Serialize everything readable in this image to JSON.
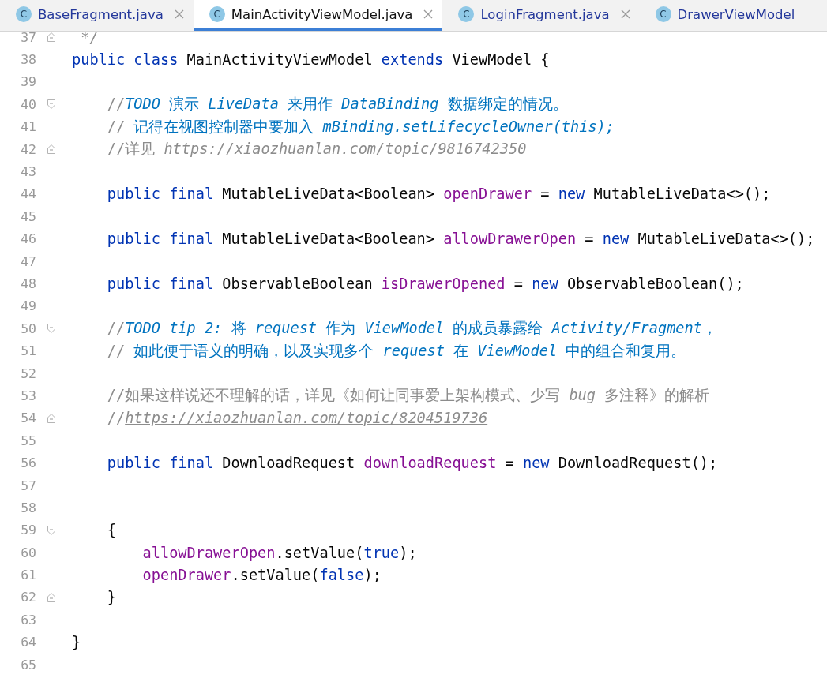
{
  "tabs": [
    {
      "label": "BaseFragment.java",
      "selected": false,
      "closable": true,
      "icon": "C"
    },
    {
      "label": "MainActivityViewModel.java",
      "selected": true,
      "closable": true,
      "icon": "C"
    },
    {
      "label": "LoginFragment.java",
      "selected": false,
      "closable": true,
      "icon": "C"
    },
    {
      "label": "DrawerViewModel",
      "selected": false,
      "closable": false,
      "icon": "C"
    }
  ],
  "lines": [
    {
      "number": "37",
      "fold": {
        "kind": "end"
      },
      "tokens": [
        {
          "kind": "doc",
          "text": " */"
        }
      ]
    },
    {
      "number": "38",
      "tokens": [
        {
          "kind": "keyword",
          "text": "public class "
        },
        {
          "kind": "plain",
          "text": "MainActivityViewModel "
        },
        {
          "kind": "keyword",
          "text": "extends "
        },
        {
          "kind": "plain",
          "text": "ViewModel {"
        }
      ]
    },
    {
      "number": "39"
    },
    {
      "number": "40",
      "fold": {
        "kind": "start"
      },
      "tokens": [
        {
          "kind": "comment",
          "text": "    //"
        },
        {
          "kind": "todo-code",
          "text": "TODO"
        },
        {
          "kind": "todo",
          "text": " 演示 "
        },
        {
          "kind": "todo-code",
          "text": "LiveData"
        },
        {
          "kind": "todo",
          "text": " 来用作 "
        },
        {
          "kind": "todo-code",
          "text": "DataBinding"
        },
        {
          "kind": "todo",
          "text": " 数据绑定的情况。"
        }
      ]
    },
    {
      "number": "41",
      "tokens": [
        {
          "kind": "comment",
          "text": "    // "
        },
        {
          "kind": "todo",
          "text": "记得在视图控制器中要加入 "
        },
        {
          "kind": "todo-code",
          "text": "mBinding.setLifecycleOwner(this);"
        }
      ]
    },
    {
      "number": "42",
      "fold": {
        "kind": "end"
      },
      "tokens": [
        {
          "kind": "comment",
          "text": "    //详见 "
        },
        {
          "kind": "link",
          "text": "https://xiaozhuanlan.com/topic/9816742350"
        }
      ]
    },
    {
      "number": "43"
    },
    {
      "number": "44",
      "tokens": [
        {
          "kind": "keyword",
          "text": "    public final "
        },
        {
          "kind": "plain",
          "text": "MutableLiveData<Boolean> "
        },
        {
          "kind": "field",
          "text": "openDrawer"
        },
        {
          "kind": "plain",
          "text": " = "
        },
        {
          "kind": "keyword",
          "text": "new "
        },
        {
          "kind": "plain",
          "text": "MutableLiveData<>();"
        }
      ]
    },
    {
      "number": "45"
    },
    {
      "number": "46",
      "tokens": [
        {
          "kind": "keyword",
          "text": "    public final "
        },
        {
          "kind": "plain",
          "text": "MutableLiveData<Boolean> "
        },
        {
          "kind": "field",
          "text": "allowDrawerOpen"
        },
        {
          "kind": "plain",
          "text": " = "
        },
        {
          "kind": "keyword",
          "text": "new "
        },
        {
          "kind": "plain",
          "text": "MutableLiveData<>();"
        }
      ]
    },
    {
      "number": "47"
    },
    {
      "number": "48",
      "tokens": [
        {
          "kind": "keyword",
          "text": "    public final "
        },
        {
          "kind": "plain",
          "text": "ObservableBoolean "
        },
        {
          "kind": "field",
          "text": "isDrawerOpened"
        },
        {
          "kind": "plain",
          "text": " = "
        },
        {
          "kind": "keyword",
          "text": "new "
        },
        {
          "kind": "plain",
          "text": "ObservableBoolean();"
        }
      ]
    },
    {
      "number": "49"
    },
    {
      "number": "50",
      "fold": {
        "kind": "start"
      },
      "tokens": [
        {
          "kind": "comment",
          "text": "    //"
        },
        {
          "kind": "todo-code",
          "text": "TODO tip 2:"
        },
        {
          "kind": "todo",
          "text": " 将 "
        },
        {
          "kind": "todo-code",
          "text": "request"
        },
        {
          "kind": "todo",
          "text": " 作为 "
        },
        {
          "kind": "todo-code",
          "text": "ViewModel"
        },
        {
          "kind": "todo",
          "text": " 的成员暴露给 "
        },
        {
          "kind": "todo-code",
          "text": "Activity/Fragment"
        },
        {
          "kind": "todo",
          "text": "，"
        }
      ]
    },
    {
      "number": "51",
      "tokens": [
        {
          "kind": "comment",
          "text": "    // "
        },
        {
          "kind": "todo",
          "text": "如此便于语义的明确，以及实现多个 "
        },
        {
          "kind": "todo-code",
          "text": "request"
        },
        {
          "kind": "todo",
          "text": " 在 "
        },
        {
          "kind": "todo-code",
          "text": "ViewModel"
        },
        {
          "kind": "todo",
          "text": " 中的组合和复用。"
        }
      ]
    },
    {
      "number": "52"
    },
    {
      "number": "53",
      "tokens": [
        {
          "kind": "comment",
          "text": "    //如果这样说还不理解的话，详见《如何让同事爱上架构模式、少写 "
        },
        {
          "kind": "doc",
          "text": "bug"
        },
        {
          "kind": "comment",
          "text": " 多注释》的解析"
        }
      ]
    },
    {
      "number": "54",
      "fold": {
        "kind": "end"
      },
      "tokens": [
        {
          "kind": "comment",
          "text": "    //"
        },
        {
          "kind": "link",
          "text": "https://xiaozhuanlan.com/topic/8204519736"
        }
      ]
    },
    {
      "number": "55"
    },
    {
      "number": "56",
      "tokens": [
        {
          "kind": "keyword",
          "text": "    public final "
        },
        {
          "kind": "plain",
          "text": "DownloadRequest "
        },
        {
          "kind": "field",
          "text": "downloadRequest"
        },
        {
          "kind": "plain",
          "text": " = "
        },
        {
          "kind": "keyword",
          "text": "new "
        },
        {
          "kind": "plain",
          "text": "DownloadRequest();"
        }
      ]
    },
    {
      "number": "57"
    },
    {
      "number": "58"
    },
    {
      "number": "59",
      "fold": {
        "kind": "start"
      },
      "tokens": [
        {
          "kind": "plain",
          "text": "    {"
        }
      ]
    },
    {
      "number": "60",
      "tokens": [
        {
          "kind": "field",
          "text": "        allowDrawerOpen"
        },
        {
          "kind": "plain",
          "text": ".setValue("
        },
        {
          "kind": "keyword",
          "text": "true"
        },
        {
          "kind": "plain",
          "text": ");"
        }
      ]
    },
    {
      "number": "61",
      "tokens": [
        {
          "kind": "field",
          "text": "        openDrawer"
        },
        {
          "kind": "plain",
          "text": ".setValue("
        },
        {
          "kind": "keyword",
          "text": "false"
        },
        {
          "kind": "plain",
          "text": ");"
        }
      ]
    },
    {
      "number": "62",
      "fold": {
        "kind": "end"
      },
      "tokens": [
        {
          "kind": "plain",
          "text": "    }"
        }
      ]
    },
    {
      "number": "63"
    },
    {
      "number": "64",
      "tokens": [
        {
          "kind": "plain",
          "text": "}"
        }
      ]
    },
    {
      "number": "65"
    }
  ]
}
